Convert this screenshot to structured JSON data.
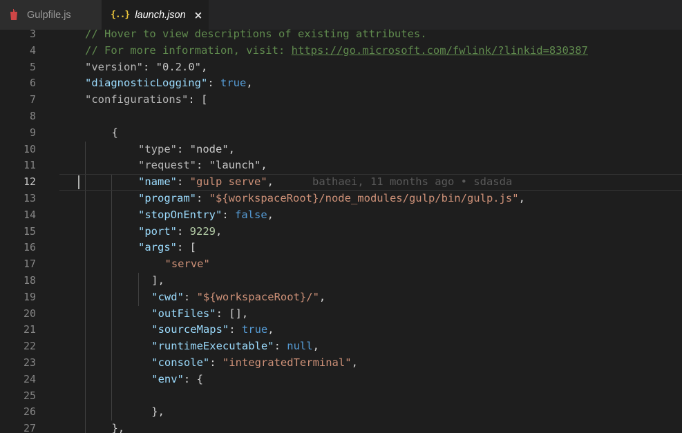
{
  "tabs": [
    {
      "label": "Gulpfile.js",
      "icon": "gulp-icon",
      "active": false
    },
    {
      "label": "launch.json",
      "icon": "json-braces-icon",
      "active": true,
      "close": "×"
    }
  ],
  "colors": {
    "background": "#1e1e1e",
    "comment": "#608b4e",
    "key": "#9cdcfe",
    "string": "#ce9178",
    "keyword": "#569cd6",
    "number": "#b5cea8",
    "gulp_icon": "#cf4646",
    "json_icon": "#e8c33b"
  },
  "current_line": 12,
  "lines": [
    {
      "n": "3",
      "indent": 0,
      "tokens": [
        {
          "t": "// Hover to view descriptions of existing attributes.",
          "c": "c-comment"
        }
      ]
    },
    {
      "n": "4",
      "indent": 0,
      "tokens": [
        {
          "t": "// For more information, visit: ",
          "c": "c-comment"
        },
        {
          "t": "https://go.microsoft.com/fwlink/?linkid=830387",
          "c": "c-link"
        }
      ]
    },
    {
      "n": "5",
      "indent": 0,
      "tokens": [
        {
          "t": "\"version\"",
          "c": "c-key-dim"
        },
        {
          "t": ": ",
          "c": "c-punc"
        },
        {
          "t": "\"0.2.0\"",
          "c": "c-str-dim"
        },
        {
          "t": ",",
          "c": "c-punc"
        }
      ]
    },
    {
      "n": "6",
      "indent": 0,
      "tokens": [
        {
          "t": "\"diagnosticLogging\"",
          "c": "c-key"
        },
        {
          "t": ": ",
          "c": "c-punc"
        },
        {
          "t": "true",
          "c": "c-bool"
        },
        {
          "t": ",",
          "c": "c-punc"
        }
      ]
    },
    {
      "n": "7",
      "indent": 0,
      "tokens": [
        {
          "t": "\"configurations\"",
          "c": "c-key-dim"
        },
        {
          "t": ": [",
          "c": "c-punc"
        }
      ]
    },
    {
      "n": "8",
      "indent": 0,
      "tokens": []
    },
    {
      "n": "9",
      "indent": 1,
      "tokens": [
        {
          "t": "{",
          "c": "c-punc"
        }
      ]
    },
    {
      "n": "10",
      "indent": 2,
      "tokens": [
        {
          "t": "\"type\"",
          "c": "c-key-dim"
        },
        {
          "t": ": ",
          "c": "c-punc"
        },
        {
          "t": "\"node\"",
          "c": "c-str-dim"
        },
        {
          "t": ",",
          "c": "c-punc"
        }
      ]
    },
    {
      "n": "11",
      "indent": 2,
      "tokens": [
        {
          "t": "\"request\"",
          "c": "c-key-dim"
        },
        {
          "t": ": ",
          "c": "c-punc"
        },
        {
          "t": "\"launch\"",
          "c": "c-str-dim"
        },
        {
          "t": ",",
          "c": "c-punc"
        }
      ]
    },
    {
      "n": "12",
      "indent": 2,
      "tokens": [
        {
          "t": "\"name\"",
          "c": "c-key"
        },
        {
          "t": ": ",
          "c": "c-punc"
        },
        {
          "t": "\"gulp serve\"",
          "c": "c-str"
        },
        {
          "t": ",",
          "c": "c-punc"
        },
        {
          "t": "      bathaei, 11 months ago • sdasda",
          "c": "c-blame"
        }
      ]
    },
    {
      "n": "13",
      "indent": 2,
      "tokens": [
        {
          "t": "\"program\"",
          "c": "c-key"
        },
        {
          "t": ": ",
          "c": "c-punc"
        },
        {
          "t": "\"${workspaceRoot}/node_modules/gulp/bin/gulp.js\"",
          "c": "c-str"
        },
        {
          "t": ",",
          "c": "c-punc"
        }
      ]
    },
    {
      "n": "14",
      "indent": 2,
      "tokens": [
        {
          "t": "\"stopOnEntry\"",
          "c": "c-key"
        },
        {
          "t": ": ",
          "c": "c-punc"
        },
        {
          "t": "false",
          "c": "c-bool"
        },
        {
          "t": ",",
          "c": "c-punc"
        }
      ]
    },
    {
      "n": "15",
      "indent": 2,
      "tokens": [
        {
          "t": "\"port\"",
          "c": "c-key"
        },
        {
          "t": ": ",
          "c": "c-punc"
        },
        {
          "t": "9229",
          "c": "c-num"
        },
        {
          "t": ",",
          "c": "c-punc"
        }
      ]
    },
    {
      "n": "16",
      "indent": 2,
      "tokens": [
        {
          "t": "\"args\"",
          "c": "c-key"
        },
        {
          "t": ": [",
          "c": "c-punc"
        }
      ]
    },
    {
      "n": "17",
      "indent": 3,
      "tokens": [
        {
          "t": "\"serve\"",
          "c": "c-str"
        }
      ]
    },
    {
      "n": "18",
      "indent": 2.5,
      "tokens": [
        {
          "t": "],",
          "c": "c-punc"
        }
      ]
    },
    {
      "n": "19",
      "indent": 2.5,
      "tokens": [
        {
          "t": "\"cwd\"",
          "c": "c-key"
        },
        {
          "t": ": ",
          "c": "c-punc"
        },
        {
          "t": "\"${workspaceRoot}/\"",
          "c": "c-str"
        },
        {
          "t": ",",
          "c": "c-punc"
        }
      ]
    },
    {
      "n": "20",
      "indent": 2.5,
      "tokens": [
        {
          "t": "\"outFiles\"",
          "c": "c-key"
        },
        {
          "t": ": [],",
          "c": "c-punc"
        }
      ]
    },
    {
      "n": "21",
      "indent": 2.5,
      "tokens": [
        {
          "t": "\"sourceMaps\"",
          "c": "c-key"
        },
        {
          "t": ": ",
          "c": "c-punc"
        },
        {
          "t": "true",
          "c": "c-bool"
        },
        {
          "t": ",",
          "c": "c-punc"
        }
      ]
    },
    {
      "n": "22",
      "indent": 2.5,
      "tokens": [
        {
          "t": "\"runtimeExecutable\"",
          "c": "c-key"
        },
        {
          "t": ": ",
          "c": "c-punc"
        },
        {
          "t": "null",
          "c": "c-bool"
        },
        {
          "t": ",",
          "c": "c-punc"
        }
      ]
    },
    {
      "n": "23",
      "indent": 2.5,
      "tokens": [
        {
          "t": "\"console\"",
          "c": "c-key"
        },
        {
          "t": ": ",
          "c": "c-punc"
        },
        {
          "t": "\"integratedTerminal\"",
          "c": "c-str"
        },
        {
          "t": ",",
          "c": "c-punc"
        }
      ]
    },
    {
      "n": "24",
      "indent": 2.5,
      "tokens": [
        {
          "t": "\"env\"",
          "c": "c-key"
        },
        {
          "t": ": {",
          "c": "c-punc"
        }
      ]
    },
    {
      "n": "25",
      "indent": 0,
      "tokens": []
    },
    {
      "n": "26",
      "indent": 2.5,
      "tokens": [
        {
          "t": "},",
          "c": "c-punc"
        }
      ]
    },
    {
      "n": "27",
      "indent": 1,
      "tokens": [
        {
          "t": "},",
          "c": "c-punc"
        }
      ]
    }
  ]
}
